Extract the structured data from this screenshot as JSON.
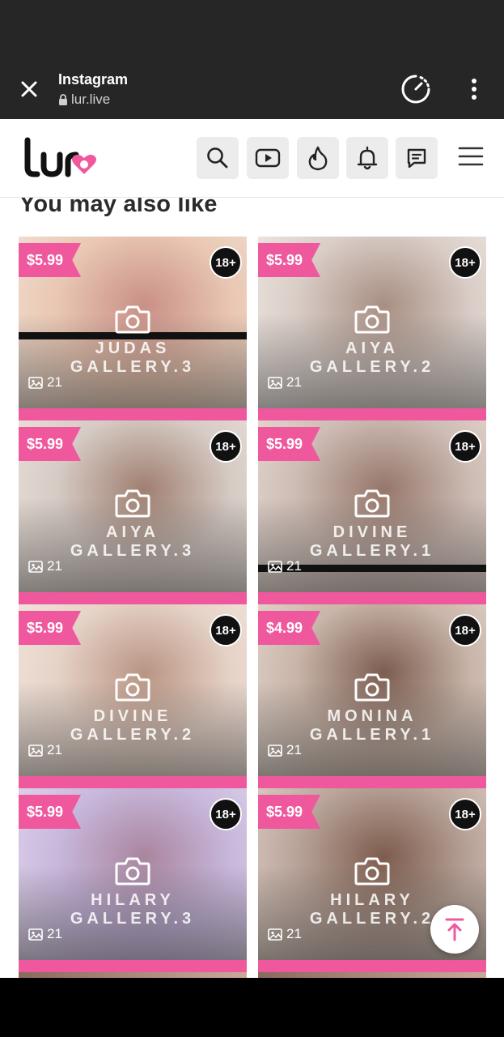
{
  "browser": {
    "app_title": "Instagram",
    "url": "lur.live"
  },
  "header": {
    "logo_alt": "Lur",
    "icons": [
      "search-icon",
      "video-icon",
      "fire-icon",
      "bell-icon",
      "chat-icon",
      "menu-icon"
    ]
  },
  "section": {
    "title": "You may also like"
  },
  "cards": [
    {
      "price": "$5.99",
      "age": "18+",
      "name": "JUDAS",
      "gallery": "GALLERY.3",
      "count": "21"
    },
    {
      "price": "$5.99",
      "age": "18+",
      "name": "AIYA",
      "gallery": "GALLERY.2",
      "count": "21"
    },
    {
      "price": "$5.99",
      "age": "18+",
      "name": "AIYA",
      "gallery": "GALLERY.3",
      "count": "21"
    },
    {
      "price": "$5.99",
      "age": "18+",
      "name": "DIVINE",
      "gallery": "GALLERY.1",
      "count": "21"
    },
    {
      "price": "$5.99",
      "age": "18+",
      "name": "DIVINE",
      "gallery": "GALLERY.2",
      "count": "21"
    },
    {
      "price": "$4.99",
      "age": "18+",
      "name": "MONINA",
      "gallery": "GALLERY.1",
      "count": "21"
    },
    {
      "price": "$5.99",
      "age": "18+",
      "name": "HILARY",
      "gallery": "GALLERY.3",
      "count": "21"
    },
    {
      "price": "$5.99",
      "age": "18+",
      "name": "HILARY",
      "gallery": "GALLERY.2",
      "count": "21"
    }
  ],
  "colors": {
    "accent_pink": "#f0589e",
    "header_bg": "#262626"
  }
}
